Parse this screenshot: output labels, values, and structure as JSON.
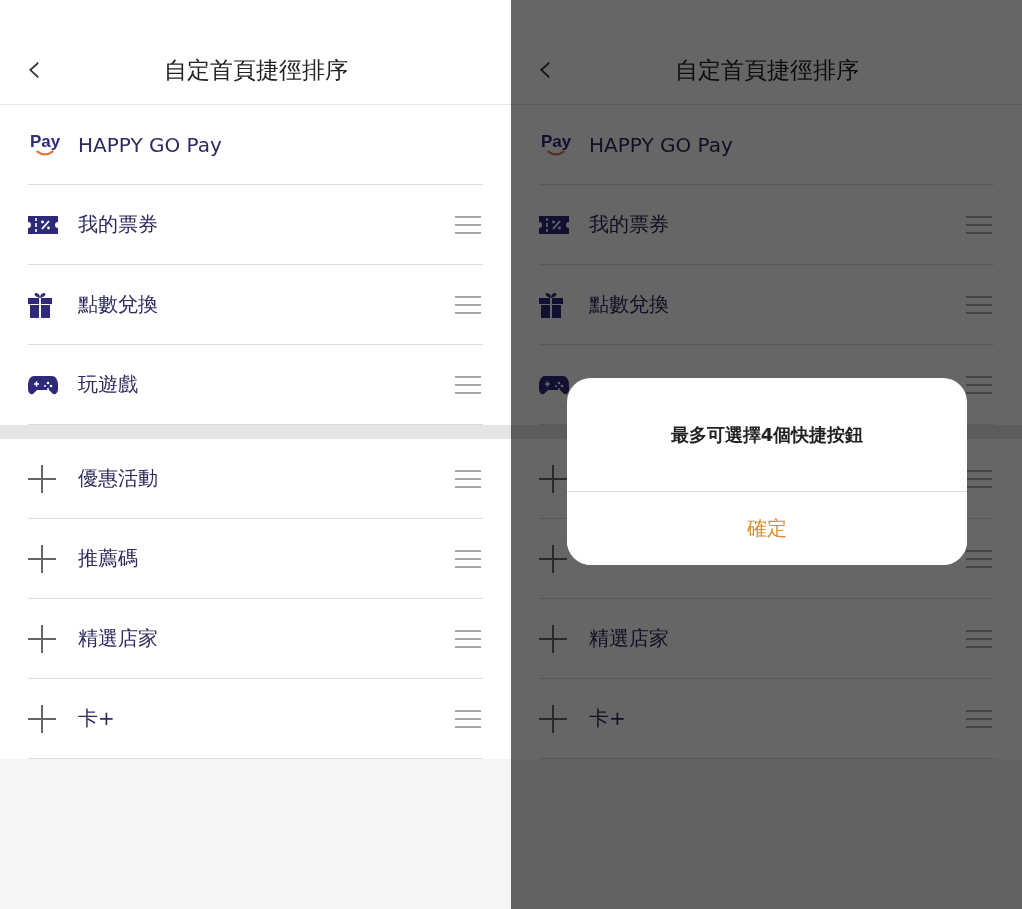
{
  "screens": [
    {
      "back_icon": "‹",
      "title": "自定首頁捷徑排序",
      "shortcuts": [
        {
          "kind": "pay",
          "logo_text": "Pay",
          "label": "HAPPY GO Pay",
          "draggable": false
        },
        {
          "kind": "ticket",
          "label": "我的票券",
          "draggable": true
        },
        {
          "kind": "gift",
          "label": "點數兌換",
          "draggable": true
        },
        {
          "kind": "gamepad",
          "label": "玩遊戲",
          "draggable": true
        }
      ],
      "other_items": [
        {
          "kind": "plus",
          "label": "優惠活動",
          "draggable": true
        },
        {
          "kind": "plus",
          "label": "推薦碼",
          "draggable": true
        },
        {
          "kind": "plus",
          "label": "精選店家",
          "draggable": true
        },
        {
          "kind": "plus",
          "label": "卡+",
          "draggable": true
        }
      ]
    },
    {
      "back_icon": "‹",
      "title": "自定首頁捷徑排序",
      "shortcuts": [
        {
          "kind": "pay",
          "logo_text": "Pay",
          "label": "HAPPY GO Pay",
          "draggable": false
        },
        {
          "kind": "ticket",
          "label": "我的票券",
          "draggable": true
        },
        {
          "kind": "gift",
          "label": "點數兌換",
          "draggable": true
        },
        {
          "kind": "gamepad",
          "draggable": true
        }
      ],
      "other_items": [
        {
          "kind": "plus",
          "draggable": true
        },
        {
          "kind": "plus",
          "draggable": true
        },
        {
          "kind": "plus",
          "label": "精選店家",
          "draggable": true
        },
        {
          "kind": "plus",
          "label": "卡+",
          "draggable": true
        }
      ],
      "dialog": {
        "message": "最多可選擇4個快捷按鈕",
        "confirm_button": "確定"
      }
    }
  ]
}
